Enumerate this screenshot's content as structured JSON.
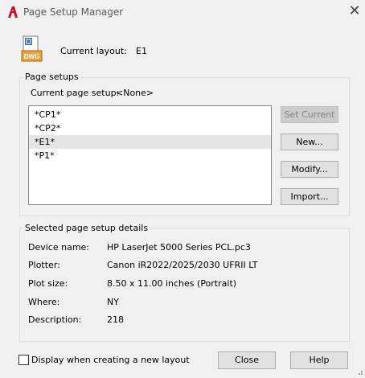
{
  "window": {
    "title": "Page Setup Manager",
    "close_glyph": "✕",
    "app_icon": "autocad-a-icon"
  },
  "current_layout": {
    "label": "Current layout:",
    "value": "E1",
    "icon": "dwg-file-icon",
    "icon_text": "DWG"
  },
  "page_setups": {
    "group_label": "Page setups",
    "current_label": "Current page setup:",
    "current_value": "<None>",
    "items": [
      "*CP1*",
      "*CP2*",
      "*E1*",
      "*P1*"
    ],
    "selected_index": 2
  },
  "buttons": {
    "set_current": "Set Current",
    "new": "New...",
    "modify": "Modify...",
    "import": "Import..."
  },
  "details": {
    "group_label": "Selected page setup details",
    "rows": [
      {
        "label": "Device name:",
        "value": "HP LaserJet 5000 Series PCL.pc3"
      },
      {
        "label": "Plotter:",
        "value": "Canon iR2022/2025/2030 UFRII LT"
      },
      {
        "label": "Plot size:",
        "value": "8.50 x 11.00 inches (Portrait)"
      },
      {
        "label": "Where:",
        "value": "NY"
      },
      {
        "label": "Description:",
        "value": "218"
      }
    ]
  },
  "footer": {
    "checkbox_label": "Display when creating a new layout",
    "checkbox_checked": false,
    "close": "Close",
    "help": "Help"
  },
  "colors": {
    "accent_red": "#c8102e",
    "dwg_blue": "#1f4e8c"
  }
}
